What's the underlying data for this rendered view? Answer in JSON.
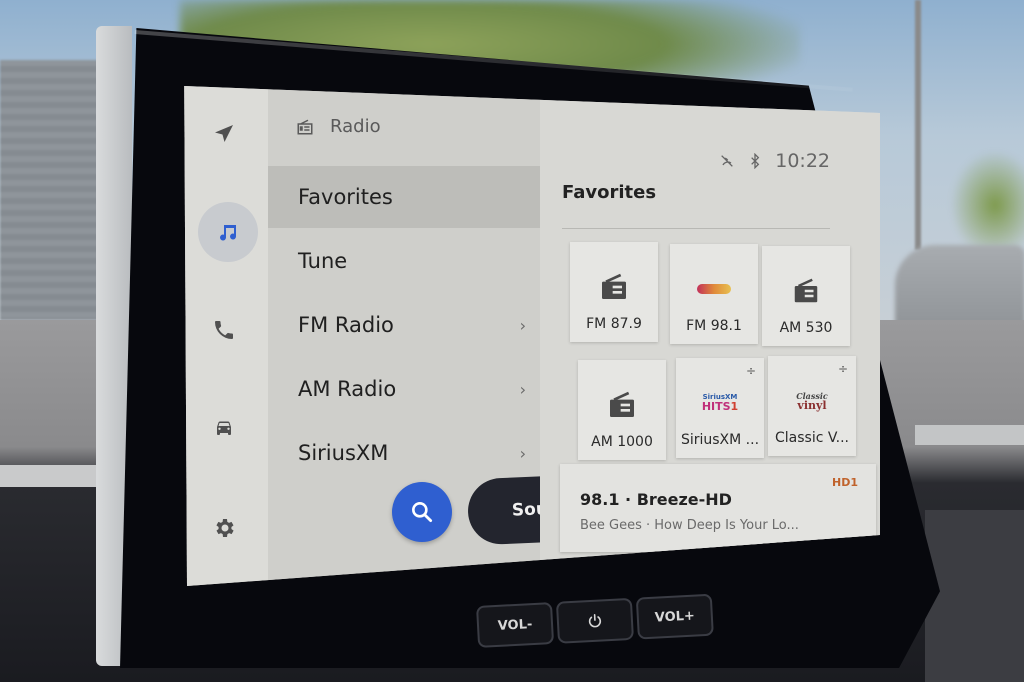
{
  "rail": {
    "items": [
      {
        "name": "navigation",
        "icon": "navigation-arrow-icon",
        "active": false
      },
      {
        "name": "media",
        "icon": "music-note-icon",
        "active": true
      },
      {
        "name": "phone",
        "icon": "phone-icon",
        "active": false
      },
      {
        "name": "vehicle",
        "icon": "car-icon",
        "active": false
      },
      {
        "name": "settings",
        "icon": "gear-icon",
        "active": false
      }
    ]
  },
  "menu": {
    "header_icon": "radio-icon",
    "header": "Radio",
    "items": [
      {
        "label": "Favorites",
        "active": true,
        "chevron": false
      },
      {
        "label": "Tune",
        "active": false,
        "chevron": false
      },
      {
        "label": "FM Radio",
        "active": false,
        "chevron": true
      },
      {
        "label": "AM Radio",
        "active": false,
        "chevron": true
      },
      {
        "label": "SiriusXM",
        "active": false,
        "chevron": true
      }
    ],
    "chevron_glyph": "›",
    "search_icon": "search-icon",
    "sources_label": "Sources"
  },
  "status": {
    "icons": [
      "no-signal-icon",
      "bluetooth-icon"
    ],
    "time": "10:22"
  },
  "favorites": {
    "title": "Favorites",
    "tiles": [
      {
        "label": "FM 87.9",
        "icon": "radio-icon",
        "more": false
      },
      {
        "label": "FM 98.1",
        "icon": "station-logo",
        "more": false
      },
      {
        "label": "AM 530",
        "icon": "radio-icon",
        "more": false
      },
      {
        "label": "AM 1000",
        "icon": "radio-icon",
        "more": false
      },
      {
        "label": "SiriusXM ...",
        "icon": "siriusxm-hits1-logo",
        "more": true
      },
      {
        "label": "Classic V...",
        "icon": "classic-vinyl-logo",
        "more": true
      }
    ],
    "more_glyph": "÷"
  },
  "now_playing": {
    "title": "98.1 · Breeze-HD",
    "subtitle": "Bee Gees · How Deep Is Your Lo...",
    "badge": "HD1"
  },
  "hardware": {
    "vol_down": "VOL-",
    "power_icon": "power-icon",
    "vol_up": "VOL+"
  },
  "colors": {
    "accent_blue": "#2f5fd0",
    "sources_bg": "#23252e",
    "hd_badge": "#c0622b"
  }
}
